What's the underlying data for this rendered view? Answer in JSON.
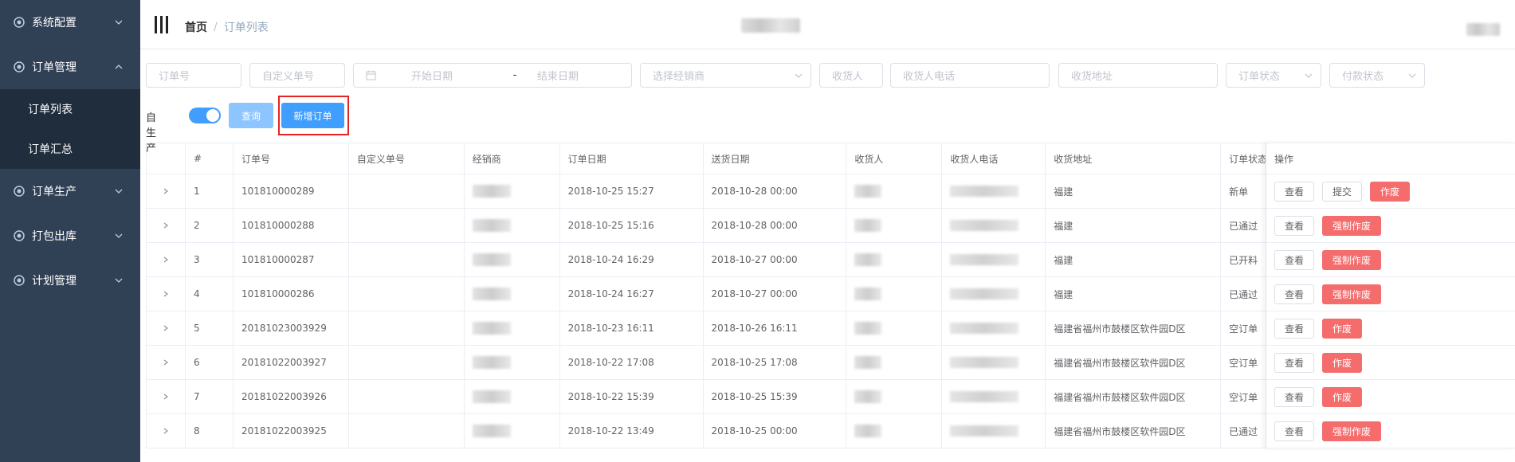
{
  "sidebar": {
    "items": [
      {
        "label": "系统配置",
        "icon": "gear-icon",
        "expanded": false
      },
      {
        "label": "订单管理",
        "icon": "gear-icon",
        "expanded": true,
        "children": [
          {
            "label": "订单列表"
          },
          {
            "label": "订单汇总"
          }
        ]
      },
      {
        "label": "订单生产",
        "icon": "gear-icon",
        "expanded": false
      },
      {
        "label": "打包出库",
        "icon": "gear-icon",
        "expanded": false
      },
      {
        "label": "计划管理",
        "icon": "gear-icon",
        "expanded": false
      }
    ]
  },
  "header": {
    "breadcrumb": {
      "home": "首页",
      "separator": "/",
      "current": "订单列表"
    }
  },
  "filters": {
    "order_no": "订单号",
    "custom_no": "自定义单号",
    "start_date": "开始日期",
    "date_sep": "-",
    "end_date": "结束日期",
    "distributor": "选择经销商",
    "receiver": "收货人",
    "receiver_phone": "收货人电话",
    "receiver_addr": "收货地址",
    "order_status": "订单状态",
    "pay_status": "付款状态"
  },
  "toolbar": {
    "self_produce_label": "自生产",
    "self_produce_on": true,
    "query_label": "查询",
    "add_order_label": "新增订单"
  },
  "table": {
    "columns": [
      "#",
      "订单号",
      "自定义单号",
      "经销商",
      "订单日期",
      "送货日期",
      "收货人",
      "收货人电话",
      "收货地址",
      "订单状态"
    ],
    "ops_header": "操作",
    "rows": [
      {
        "idx": "1",
        "order_no": "101810000289",
        "custom_no": "",
        "order_date": "2018-10-25 15:27",
        "delivery_date": "2018-10-28 00:00",
        "address": "福建",
        "status": "新单",
        "ops": [
          "查看",
          "提交",
          "作废"
        ]
      },
      {
        "idx": "2",
        "order_no": "101810000288",
        "custom_no": "",
        "order_date": "2018-10-25 15:16",
        "delivery_date": "2018-10-28 00:00",
        "address": "福建",
        "status": "已通过",
        "ops": [
          "查看",
          "强制作废"
        ]
      },
      {
        "idx": "3",
        "order_no": "101810000287",
        "custom_no": "",
        "order_date": "2018-10-24 16:29",
        "delivery_date": "2018-10-27 00:00",
        "address": "福建",
        "status": "已开料",
        "ops": [
          "查看",
          "强制作废"
        ]
      },
      {
        "idx": "4",
        "order_no": "101810000286",
        "custom_no": "",
        "order_date": "2018-10-24 16:27",
        "delivery_date": "2018-10-27 00:00",
        "address": "福建",
        "status": "已通过",
        "ops": [
          "查看",
          "强制作废"
        ]
      },
      {
        "idx": "5",
        "order_no": "20181023003929",
        "custom_no": "",
        "order_date": "2018-10-23 16:11",
        "delivery_date": "2018-10-26 16:11",
        "address": "福建省福州市鼓楼区软件园D区",
        "status": "空订单",
        "ops": [
          "查看",
          "作废"
        ]
      },
      {
        "idx": "6",
        "order_no": "20181022003927",
        "custom_no": "",
        "order_date": "2018-10-22 17:08",
        "delivery_date": "2018-10-25 17:08",
        "address": "福建省福州市鼓楼区软件园D区",
        "status": "空订单",
        "ops": [
          "查看",
          "作废"
        ]
      },
      {
        "idx": "7",
        "order_no": "20181022003926",
        "custom_no": "",
        "order_date": "2018-10-22 15:39",
        "delivery_date": "2018-10-25 15:39",
        "address": "福建省福州市鼓楼区软件园D区",
        "status": "空订单",
        "ops": [
          "查看",
          "作废"
        ]
      },
      {
        "idx": "8",
        "order_no": "20181022003925",
        "custom_no": "",
        "order_date": "2018-10-22 13:49",
        "delivery_date": "2018-10-25 00:00",
        "address": "福建省福州市鼓楼区软件园D区",
        "status": "已通过",
        "ops": [
          "查看",
          "强制作废"
        ]
      }
    ]
  },
  "colors": {
    "sidebar_bg": "#304156",
    "submenu_bg": "#1f2d3d",
    "primary": "#409eff",
    "primary_light": "#8cc5ff",
    "danger": "#f56c6c",
    "highlight_border": "#e62323"
  }
}
